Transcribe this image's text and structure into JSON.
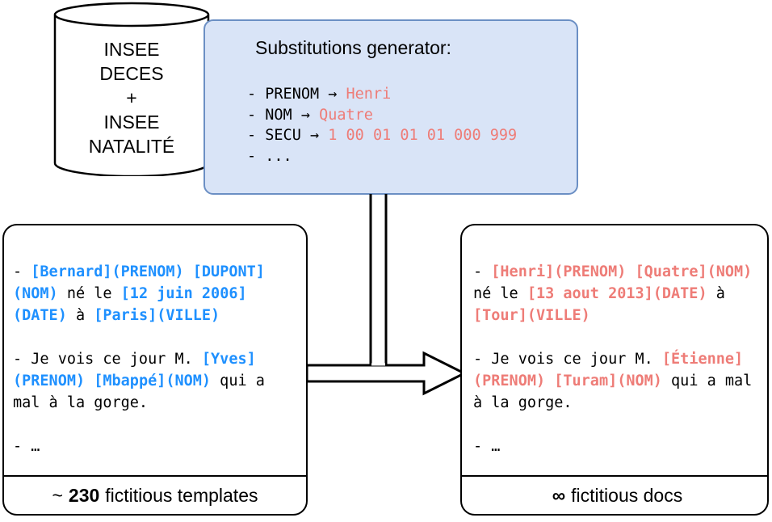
{
  "database": {
    "name": "insee-database-cylinder",
    "label": "INSEE\nDECES\n+\nINSEE\nNATALITÉ"
  },
  "generator": {
    "title": "Substitutions generator:",
    "lines": [
      {
        "prefix": "- PRENOM → ",
        "value": "Henri"
      },
      {
        "prefix": "- NOM → ",
        "value": "Quatre"
      },
      {
        "prefix": "- SECU → ",
        "value": "1 00 01 01 01 000 999"
      },
      {
        "prefix": "- ...",
        "value": ""
      }
    ],
    "text": "- PRENOM → Henri\n- NOM → Quatre\n- SECU → 1 00 01 01 01 000 999\n- ...",
    "box_fill": "#d9e4f7",
    "box_border": "#6b8fc4"
  },
  "templates_doc": {
    "body_text": "- [Bernard](PRENOM) [DUPONT](NOM) né le [12 juin 2006](DATE) à [Paris](VILLE)\n\n- Je vois ce jour M. [Yves](PRENOM) [Mbappé](NOM) qui a mal à la gorge.\n\n- …",
    "entities": [
      "[Bernard](PRENOM)",
      "[DUPONT](NOM)",
      "[12 juin 2006](DATE)",
      "[Paris](VILLE)",
      "[Yves](PRENOM)",
      "[Mbappé](NOM)"
    ],
    "plain_fragments": [
      "- ",
      " né le ",
      " à ",
      "- Je vois ce jour M. ",
      " qui a mal à la gorge.",
      "- …"
    ],
    "highlight_color": "#1e90ff",
    "footer": {
      "approx": "~",
      "count": "230",
      "tail": "fictitious templates"
    }
  },
  "generated_doc": {
    "body_text": "- [Henri](PRENOM) [Quatre](NOM) né le [13 aout 2013](DATE) à [Tour](VILLE)\n\n- Je vois ce jour M. [Étienne](PRENOM) [Turam](NOM) qui a mal à la gorge.\n\n- …",
    "entities": [
      "[Henri](PRENOM)",
      "[Quatre](NOM)",
      "[13 aout 2013](DATE)",
      "[Tour](VILLE)",
      "[Étienne](PRENOM)",
      "[Turam](NOM)"
    ],
    "plain_fragments": [
      "- ",
      " né le ",
      " à ",
      "- Je vois ce jour M. ",
      " qui a mal à la gorge.",
      "- …"
    ],
    "highlight_color": "#ee7c77",
    "footer": {
      "approx": "",
      "count": "∞",
      "tail": "fictitious docs"
    }
  },
  "flow": {
    "arrow_name": "generation-arrow",
    "direction": "left-to-right",
    "connector_count": 2
  }
}
